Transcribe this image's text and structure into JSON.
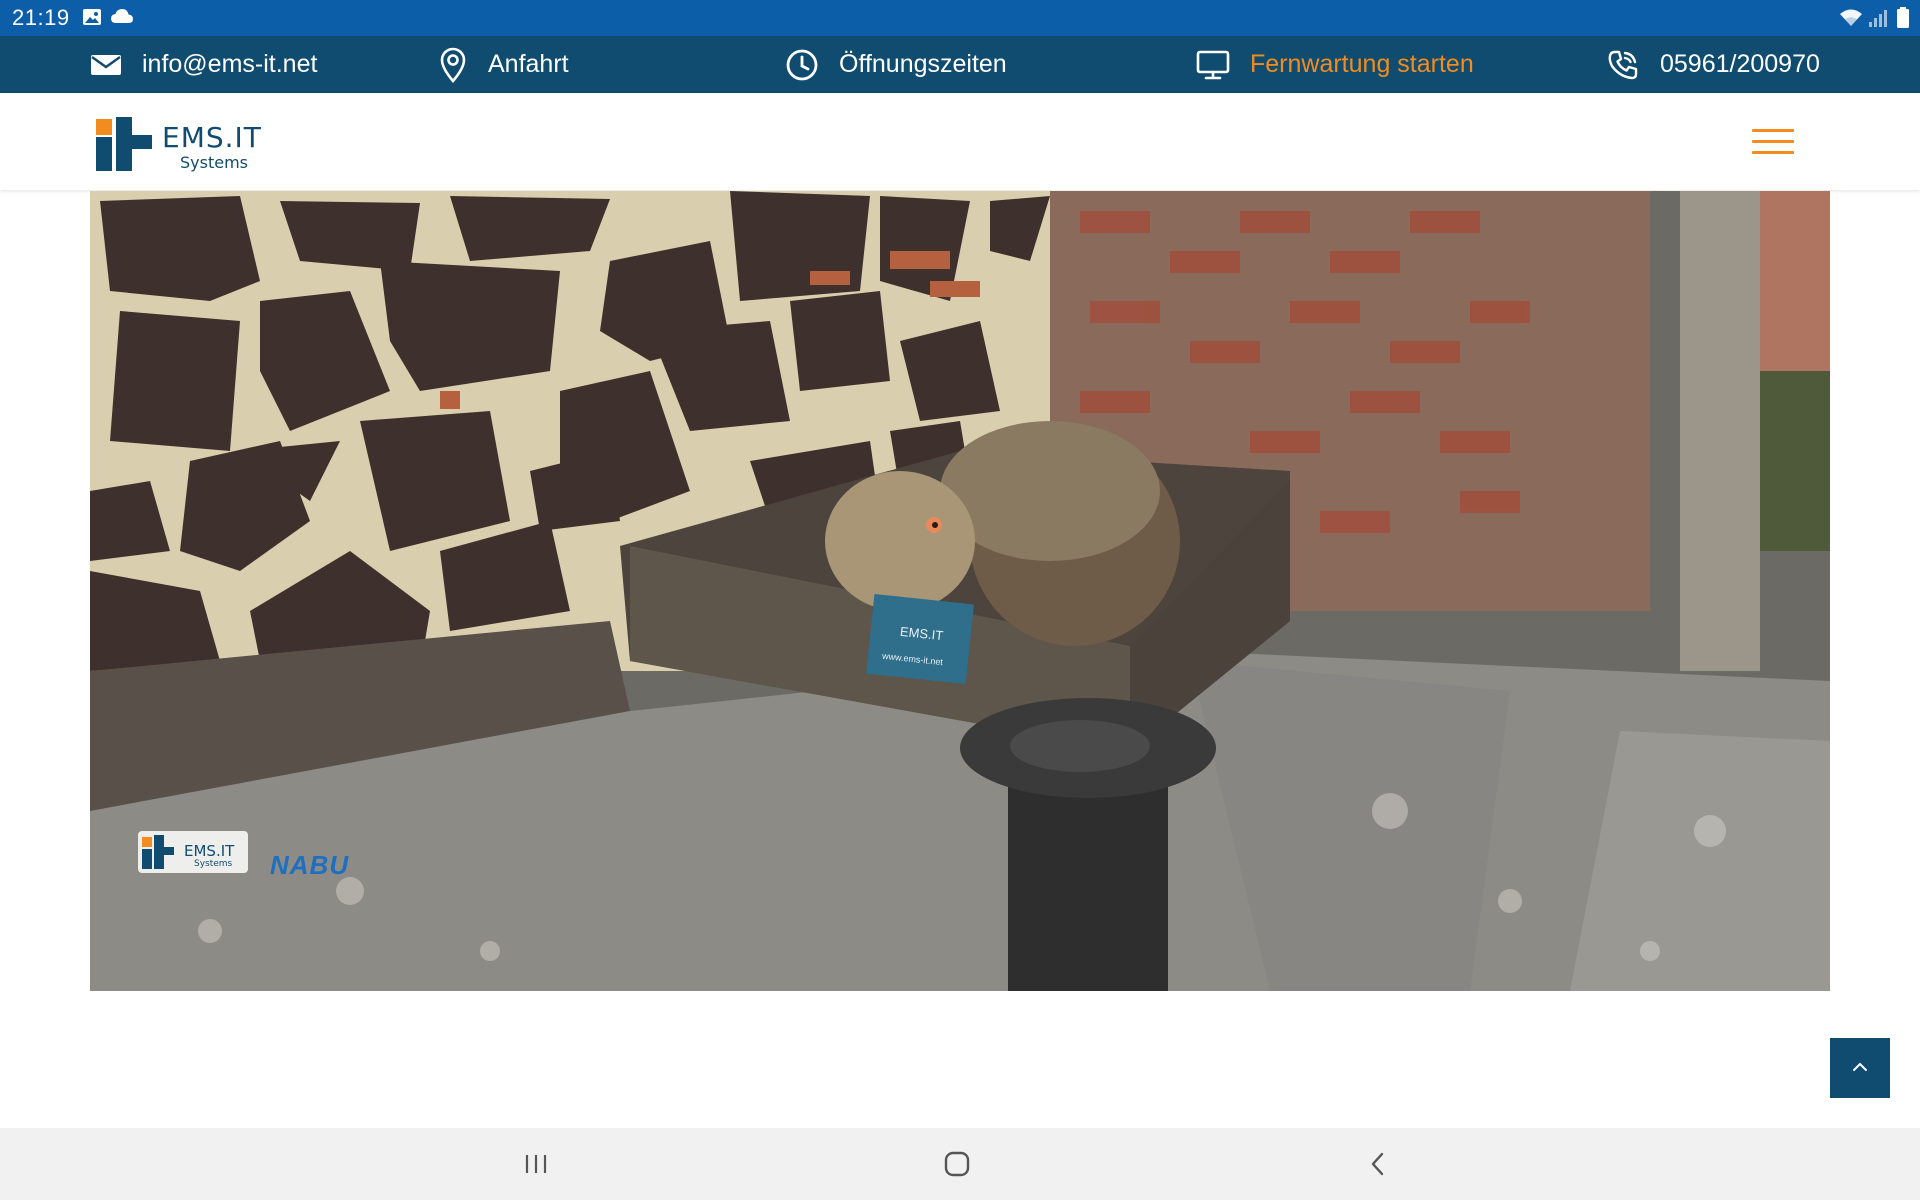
{
  "status_bar": {
    "time": "21:19",
    "left_icons": [
      "image-icon",
      "cloud-icon"
    ],
    "right_icons": [
      "wifi-icon",
      "signal-icon",
      "battery-icon"
    ]
  },
  "topbar": {
    "items": [
      {
        "icon": "mail-icon",
        "label": "info@ems-it.net"
      },
      {
        "icon": "location-pin-icon",
        "label": "Anfahrt"
      },
      {
        "icon": "clock-icon",
        "label": "Öffnungszeiten"
      },
      {
        "icon": "monitor-icon",
        "label": "Fernwartung starten"
      },
      {
        "icon": "phone-icon",
        "label": "05961/200970"
      }
    ],
    "accent_color": "#f28c1e",
    "background": "#0f4c6f"
  },
  "header": {
    "logo_word": "EMS.IT",
    "logo_sub": "Systems",
    "menu_icon": "hamburger-menu-icon"
  },
  "webcam": {
    "overlay_logo_word": "EMS.IT",
    "overlay_logo_sub": "Systems",
    "overlay_partner": "NABU",
    "box_sign_word": "EMS.IT",
    "box_sign_url": "www.ems-it.net"
  },
  "back_to_top": {
    "icon": "chevron-up-icon"
  },
  "nav_bar": {
    "icons": [
      "recent-apps-icon",
      "home-icon",
      "back-icon"
    ]
  }
}
